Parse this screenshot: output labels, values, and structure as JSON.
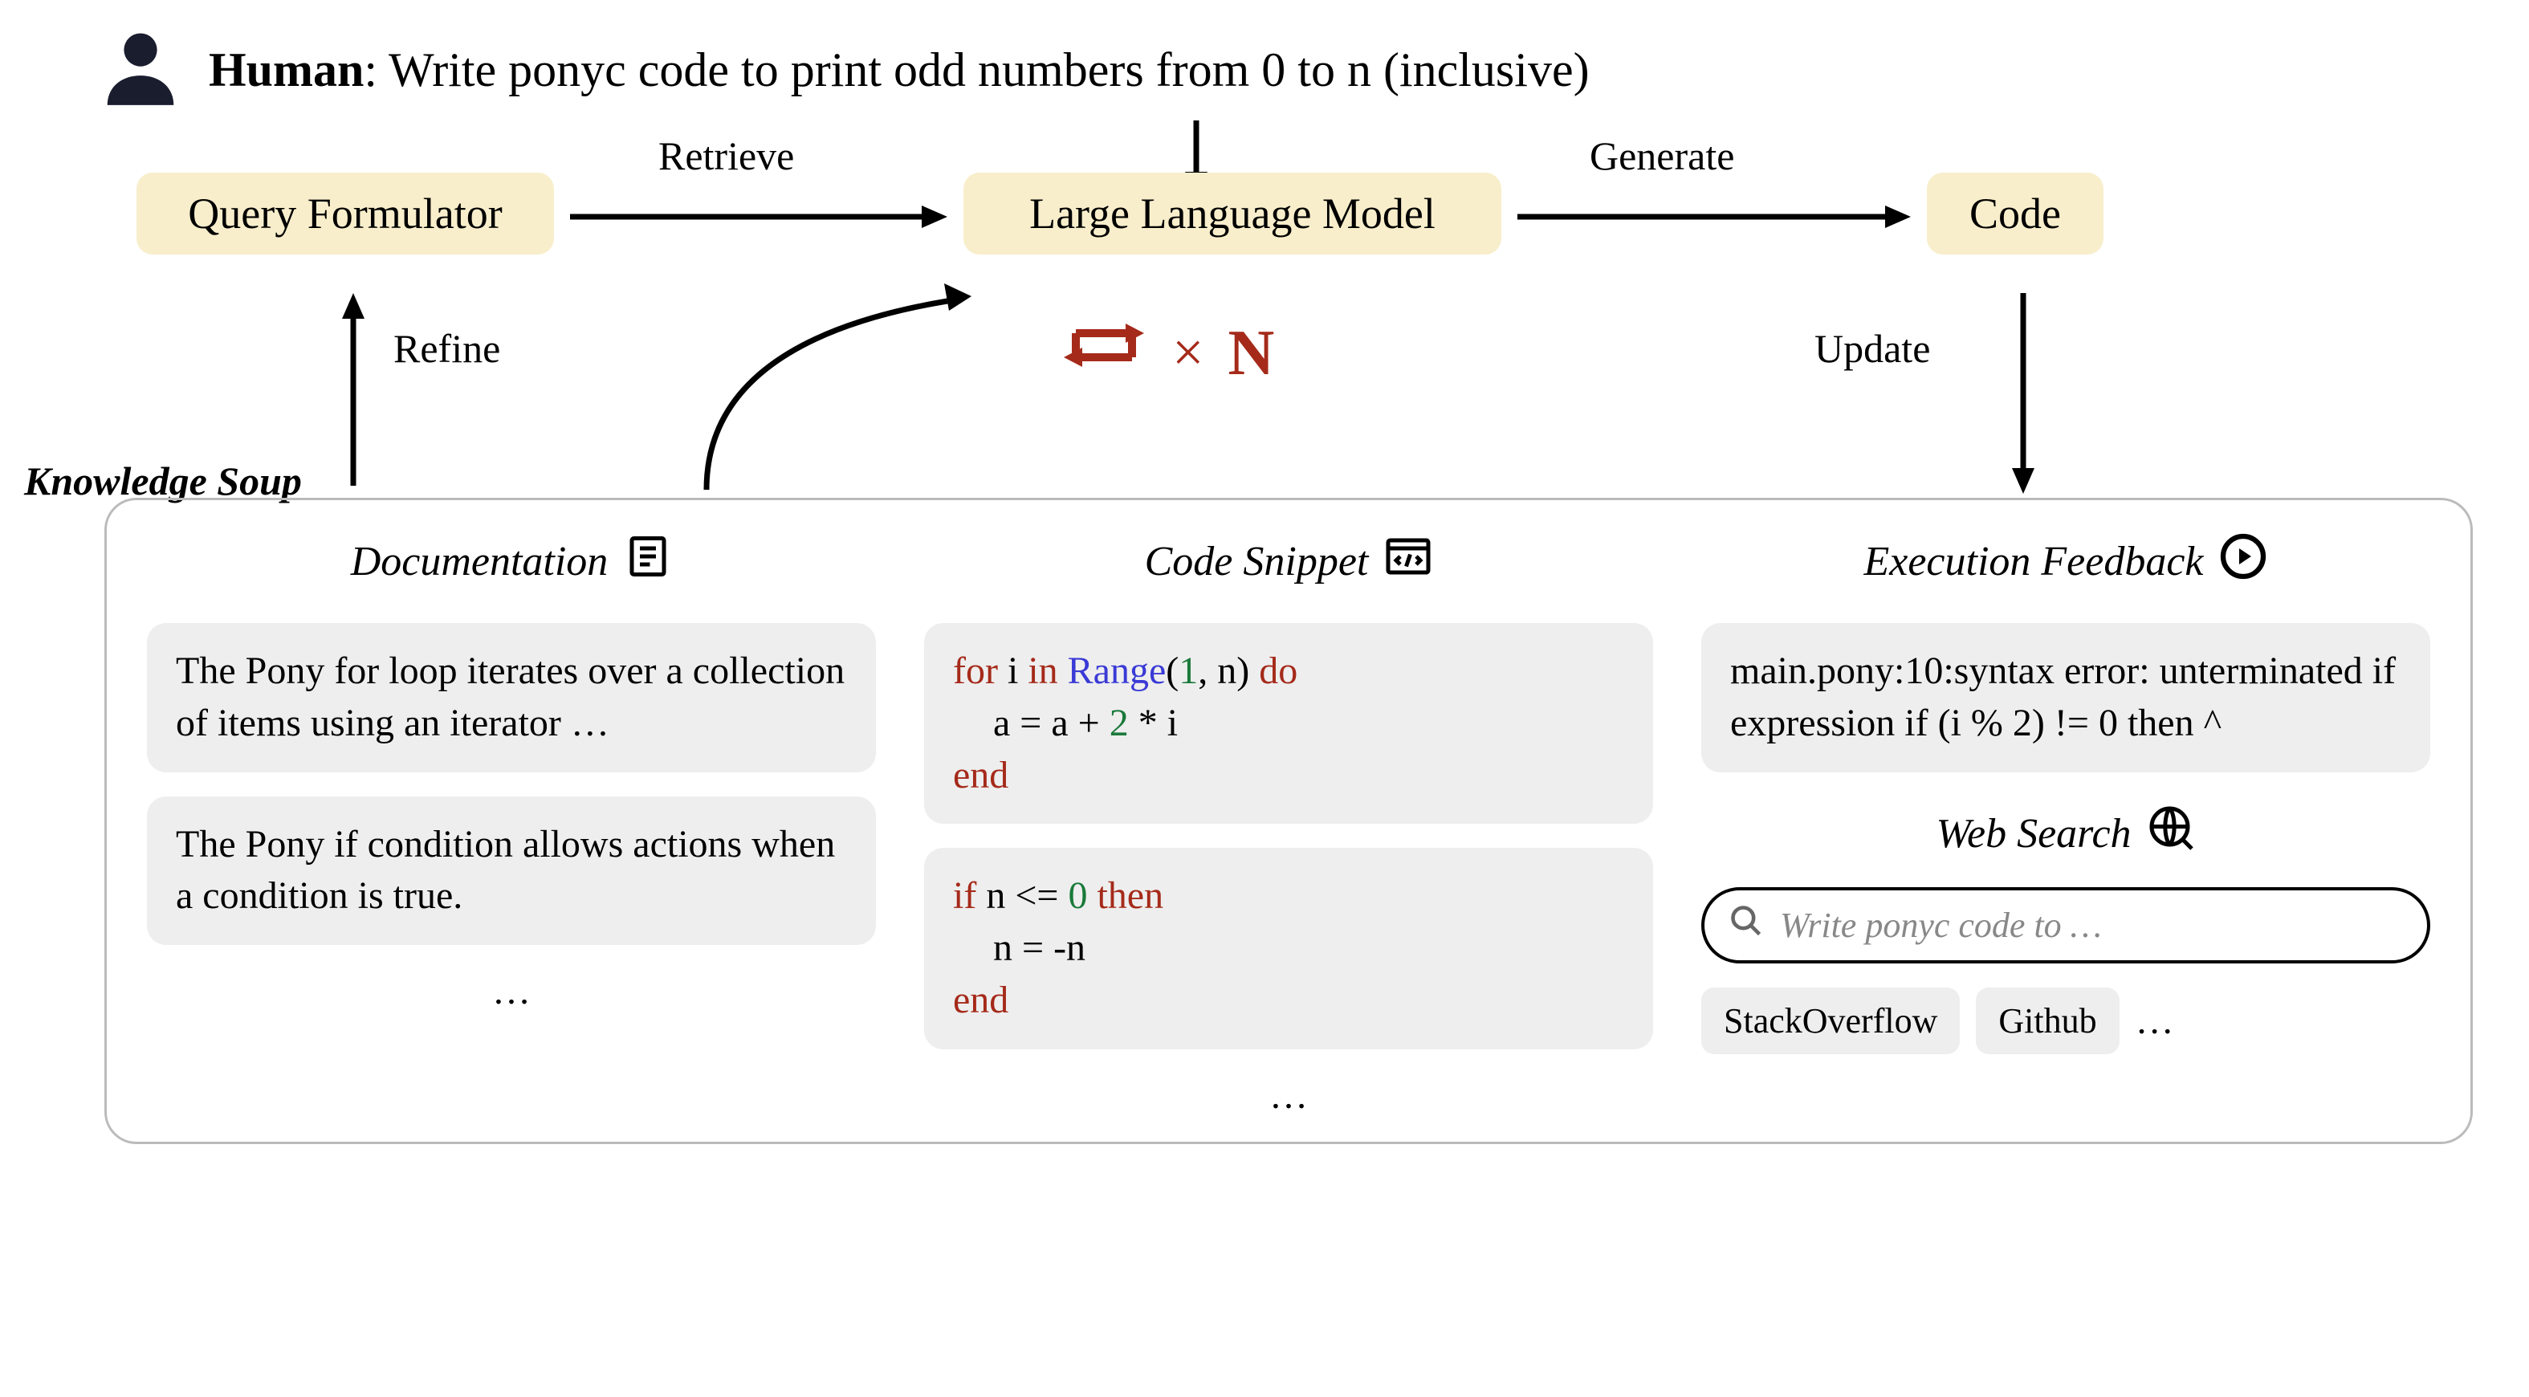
{
  "human": {
    "speaker": "Human",
    "prompt": "Write ponyc code to print odd numbers from 0 to n (inclusive)"
  },
  "flow": {
    "query_formulator": "Query Formulator",
    "llm": "Large Language Model",
    "code": "Code",
    "retrieve_label": "Retrieve",
    "generate_label": "Generate",
    "refine_label": "Refine",
    "update_label": "Update"
  },
  "iteration": {
    "times": "×",
    "count_symbol": "N"
  },
  "soup": {
    "title": "Knowledge Soup",
    "documentation": {
      "title": "Documentation",
      "items": [
        "The Pony for loop iterates over a collection of items using an iterator …",
        "The Pony if condition allows actions when a condition is true."
      ]
    },
    "code_snippet": {
      "title": "Code Snippet",
      "snippets": [
        {
          "l1_for": "for",
          "l1_var": " i ",
          "l1_in": "in",
          "l1_range": " Range",
          "l1_args_open": "(",
          "l1_one": "1",
          "l1_rest": ", n) ",
          "l1_do": "do",
          "l2": "a = a + 2 * i",
          "l2_two": "2",
          "l3_end": "end"
        },
        {
          "l1_if": "if",
          "l1_cond": " n <= ",
          "l1_zero": "0",
          "l1_then": " then",
          "l2": "n = -n",
          "l3_end": "end"
        }
      ]
    },
    "execution_feedback": {
      "title": "Execution Feedback",
      "text": "main.pony:10:syntax error: unterminated if expression if (i % 2) != 0 then ^"
    },
    "web_search": {
      "title": "Web Search",
      "placeholder": "Write ponyc code to …",
      "chips": [
        "StackOverflow",
        "Github"
      ],
      "ellipsis": "…"
    },
    "ellipsis": "…"
  }
}
